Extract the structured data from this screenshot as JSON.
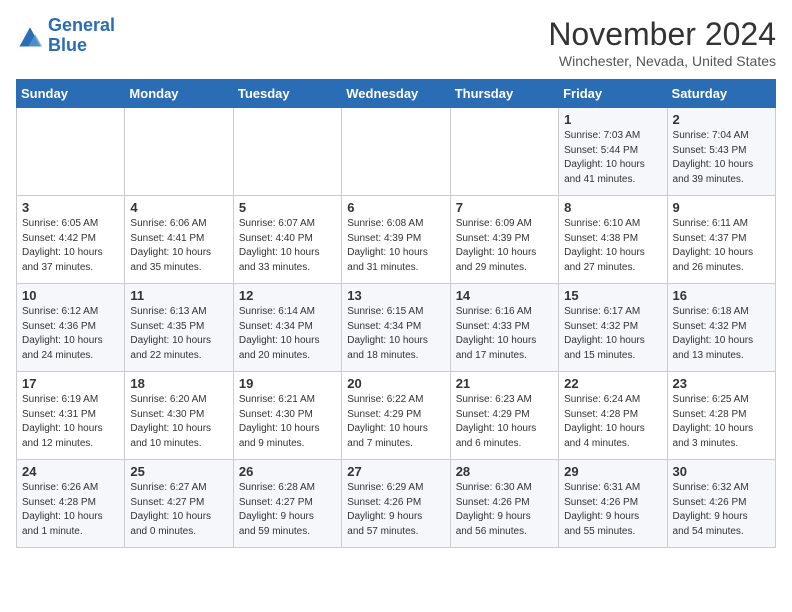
{
  "header": {
    "logo_line1": "General",
    "logo_line2": "Blue",
    "month": "November 2024",
    "location": "Winchester, Nevada, United States"
  },
  "days_of_week": [
    "Sunday",
    "Monday",
    "Tuesday",
    "Wednesday",
    "Thursday",
    "Friday",
    "Saturday"
  ],
  "weeks": [
    [
      {
        "day": "",
        "info": ""
      },
      {
        "day": "",
        "info": ""
      },
      {
        "day": "",
        "info": ""
      },
      {
        "day": "",
        "info": ""
      },
      {
        "day": "",
        "info": ""
      },
      {
        "day": "1",
        "info": "Sunrise: 7:03 AM\nSunset: 5:44 PM\nDaylight: 10 hours\nand 41 minutes."
      },
      {
        "day": "2",
        "info": "Sunrise: 7:04 AM\nSunset: 5:43 PM\nDaylight: 10 hours\nand 39 minutes."
      }
    ],
    [
      {
        "day": "3",
        "info": "Sunrise: 6:05 AM\nSunset: 4:42 PM\nDaylight: 10 hours\nand 37 minutes."
      },
      {
        "day": "4",
        "info": "Sunrise: 6:06 AM\nSunset: 4:41 PM\nDaylight: 10 hours\nand 35 minutes."
      },
      {
        "day": "5",
        "info": "Sunrise: 6:07 AM\nSunset: 4:40 PM\nDaylight: 10 hours\nand 33 minutes."
      },
      {
        "day": "6",
        "info": "Sunrise: 6:08 AM\nSunset: 4:39 PM\nDaylight: 10 hours\nand 31 minutes."
      },
      {
        "day": "7",
        "info": "Sunrise: 6:09 AM\nSunset: 4:39 PM\nDaylight: 10 hours\nand 29 minutes."
      },
      {
        "day": "8",
        "info": "Sunrise: 6:10 AM\nSunset: 4:38 PM\nDaylight: 10 hours\nand 27 minutes."
      },
      {
        "day": "9",
        "info": "Sunrise: 6:11 AM\nSunset: 4:37 PM\nDaylight: 10 hours\nand 26 minutes."
      }
    ],
    [
      {
        "day": "10",
        "info": "Sunrise: 6:12 AM\nSunset: 4:36 PM\nDaylight: 10 hours\nand 24 minutes."
      },
      {
        "day": "11",
        "info": "Sunrise: 6:13 AM\nSunset: 4:35 PM\nDaylight: 10 hours\nand 22 minutes."
      },
      {
        "day": "12",
        "info": "Sunrise: 6:14 AM\nSunset: 4:34 PM\nDaylight: 10 hours\nand 20 minutes."
      },
      {
        "day": "13",
        "info": "Sunrise: 6:15 AM\nSunset: 4:34 PM\nDaylight: 10 hours\nand 18 minutes."
      },
      {
        "day": "14",
        "info": "Sunrise: 6:16 AM\nSunset: 4:33 PM\nDaylight: 10 hours\nand 17 minutes."
      },
      {
        "day": "15",
        "info": "Sunrise: 6:17 AM\nSunset: 4:32 PM\nDaylight: 10 hours\nand 15 minutes."
      },
      {
        "day": "16",
        "info": "Sunrise: 6:18 AM\nSunset: 4:32 PM\nDaylight: 10 hours\nand 13 minutes."
      }
    ],
    [
      {
        "day": "17",
        "info": "Sunrise: 6:19 AM\nSunset: 4:31 PM\nDaylight: 10 hours\nand 12 minutes."
      },
      {
        "day": "18",
        "info": "Sunrise: 6:20 AM\nSunset: 4:30 PM\nDaylight: 10 hours\nand 10 minutes."
      },
      {
        "day": "19",
        "info": "Sunrise: 6:21 AM\nSunset: 4:30 PM\nDaylight: 10 hours\nand 9 minutes."
      },
      {
        "day": "20",
        "info": "Sunrise: 6:22 AM\nSunset: 4:29 PM\nDaylight: 10 hours\nand 7 minutes."
      },
      {
        "day": "21",
        "info": "Sunrise: 6:23 AM\nSunset: 4:29 PM\nDaylight: 10 hours\nand 6 minutes."
      },
      {
        "day": "22",
        "info": "Sunrise: 6:24 AM\nSunset: 4:28 PM\nDaylight: 10 hours\nand 4 minutes."
      },
      {
        "day": "23",
        "info": "Sunrise: 6:25 AM\nSunset: 4:28 PM\nDaylight: 10 hours\nand 3 minutes."
      }
    ],
    [
      {
        "day": "24",
        "info": "Sunrise: 6:26 AM\nSunset: 4:28 PM\nDaylight: 10 hours\nand 1 minute."
      },
      {
        "day": "25",
        "info": "Sunrise: 6:27 AM\nSunset: 4:27 PM\nDaylight: 10 hours\nand 0 minutes."
      },
      {
        "day": "26",
        "info": "Sunrise: 6:28 AM\nSunset: 4:27 PM\nDaylight: 9 hours\nand 59 minutes."
      },
      {
        "day": "27",
        "info": "Sunrise: 6:29 AM\nSunset: 4:26 PM\nDaylight: 9 hours\nand 57 minutes."
      },
      {
        "day": "28",
        "info": "Sunrise: 6:30 AM\nSunset: 4:26 PM\nDaylight: 9 hours\nand 56 minutes."
      },
      {
        "day": "29",
        "info": "Sunrise: 6:31 AM\nSunset: 4:26 PM\nDaylight: 9 hours\nand 55 minutes."
      },
      {
        "day": "30",
        "info": "Sunrise: 6:32 AM\nSunset: 4:26 PM\nDaylight: 9 hours\nand 54 minutes."
      }
    ]
  ]
}
